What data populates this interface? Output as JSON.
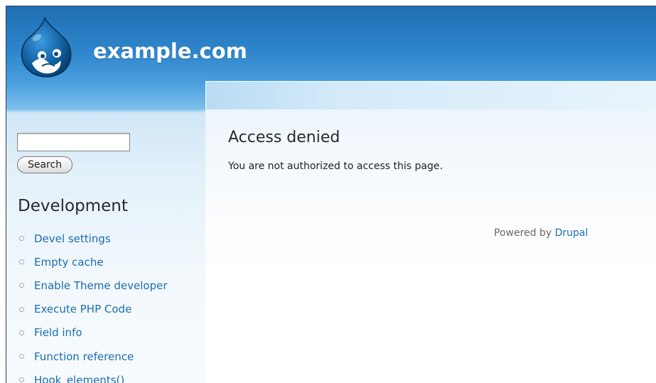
{
  "header": {
    "site_name": "example.com",
    "logo_icon": "drupal-drop-logo"
  },
  "sidebar": {
    "search": {
      "value": "",
      "placeholder": "",
      "button_label": "Search"
    },
    "block_title": "Development",
    "menu": [
      {
        "label": "Devel settings"
      },
      {
        "label": "Empty cache"
      },
      {
        "label": "Enable Theme developer"
      },
      {
        "label": "Execute PHP Code"
      },
      {
        "label": "Field info"
      },
      {
        "label": "Function reference"
      },
      {
        "label": "Hook_elements()"
      }
    ]
  },
  "main": {
    "title": "Access denied",
    "message": "You are not authorized to access this page."
  },
  "footer": {
    "powered_text": "Powered by",
    "powered_link": "Drupal"
  },
  "colors": {
    "header_blue": "#2f86cc",
    "link": "#1a6db0",
    "sidebar_bg": "#e4f1fa"
  }
}
